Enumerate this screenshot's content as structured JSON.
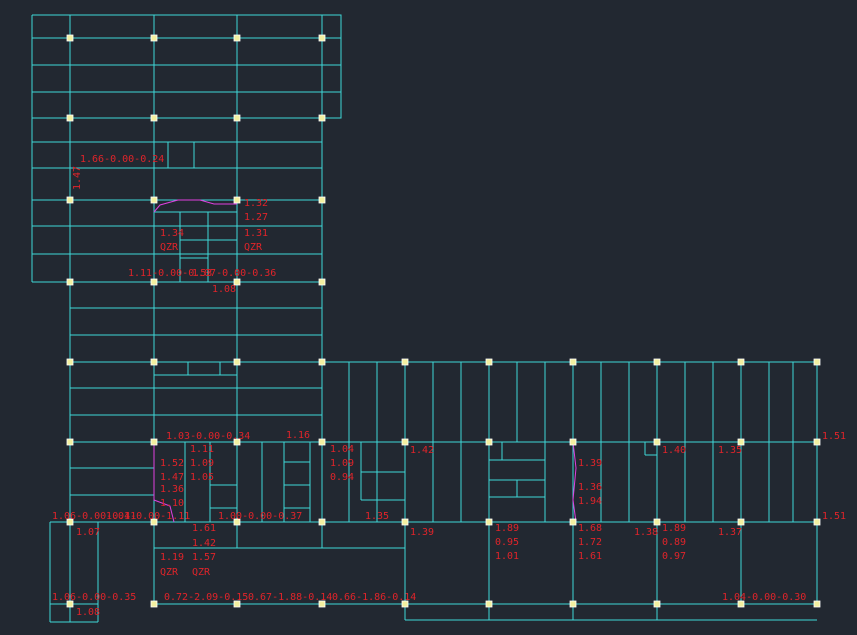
{
  "drawing": {
    "background": "#222831",
    "beam_color": "#3fd7d7",
    "column_color": "#f3f0a0",
    "label_color": "#e0242a",
    "accent_color": "#e040e0"
  },
  "labels": {
    "l01": "1.66-0.00-0.24",
    "l02": "1.47",
    "l03": "1.32",
    "l04": "1.27",
    "l05": "1.34",
    "l06": "QZR",
    "l07": "1.31",
    "l08": "QZR",
    "l09": "1.11-0.00-0.53",
    "l10": "1.07-0.00-0.36",
    "l11": "1.08",
    "l12": "1.03-0.00-0.34",
    "l13": "1.11",
    "l14": "1.09",
    "l15": "1.05",
    "l16": "1.52",
    "l17": "1.47",
    "l18": "1.36",
    "l19": "1.10",
    "l20": "1.00-0.00-0.37",
    "l21": "1.06-0.00-0.41",
    "l22": "1.01-0.00-1.11",
    "l23": "1.07",
    "l24": "1.61",
    "l25": "1.42",
    "l26": "1.19",
    "l27": "1.57",
    "l28": "QZR",
    "l29": "QZR",
    "l30": "1.16",
    "l31": "1.09",
    "l32": "1.42",
    "l33": "1.35",
    "l34": "1.39",
    "l35": "1.40",
    "l36": "1.35",
    "l37": "1.89",
    "l38": "0.95",
    "l39": "1.01",
    "l40": "1.68",
    "l41": "1.72",
    "l42": "1.61",
    "l43": "1.89",
    "l44": "0.89",
    "l45": "0.97",
    "l46": "1.37",
    "l47": "1.38",
    "l48": "1.39",
    "l49": "1.04",
    "l50": "0.94",
    "l51": "1.06-0.00-0.35",
    "l52": "1.08",
    "l53": "0.72-2.09-0.15",
    "l54": "0.67-1.88-0.14",
    "l55": "0.66-1.86-0.14",
    "l56": "1.04-0.00-0.30",
    "l57": "1.51",
    "l58": "1.51",
    "l59": "1.36",
    "l60": "1.94"
  }
}
